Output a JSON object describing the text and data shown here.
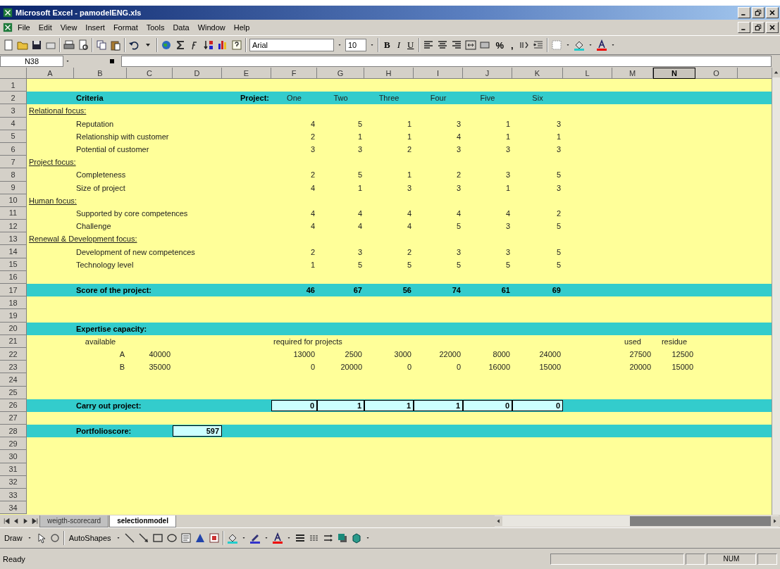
{
  "window": {
    "title": "Microsoft Excel - pamodelENG.xls"
  },
  "menu": [
    "File",
    "Edit",
    "View",
    "Insert",
    "Format",
    "Tools",
    "Data",
    "Window",
    "Help"
  ],
  "formatting": {
    "font": "Arial",
    "size": "10",
    "style_buttons": [
      "B",
      "I",
      "U"
    ],
    "number_buttons": [
      "%",
      ","
    ]
  },
  "formula_bar": {
    "name_box": "N38"
  },
  "columns": [
    {
      "label": "A",
      "selected": false
    },
    {
      "label": "B",
      "selected": false
    },
    {
      "label": "C",
      "selected": false
    },
    {
      "label": "D",
      "selected": false
    },
    {
      "label": "E",
      "selected": false
    },
    {
      "label": "F",
      "selected": false
    },
    {
      "label": "G",
      "selected": false
    },
    {
      "label": "H",
      "selected": false
    },
    {
      "label": "I",
      "selected": false
    },
    {
      "label": "J",
      "selected": false
    },
    {
      "label": "K",
      "selected": false
    },
    {
      "label": "L",
      "selected": false
    },
    {
      "label": "M",
      "selected": false
    },
    {
      "label": "N",
      "selected": true
    },
    {
      "label": "O",
      "selected": false
    }
  ],
  "rows": [
    {
      "number": "1",
      "band": false,
      "kind": "blank"
    },
    {
      "number": "2",
      "band": true,
      "kind": "header",
      "label": "Criteria",
      "caption": "Project:",
      "values": [
        "One",
        "Two",
        "Three",
        "Four",
        "Five",
        "Six"
      ]
    },
    {
      "number": "3",
      "band": false,
      "kind": "section",
      "label": "Relational focus:"
    },
    {
      "number": "4",
      "band": false,
      "kind": "item",
      "label": "Reputation",
      "values": [
        "4",
        "5",
        "1",
        "3",
        "1",
        "3"
      ]
    },
    {
      "number": "5",
      "band": false,
      "kind": "item",
      "label": "Relationship with customer",
      "values": [
        "2",
        "1",
        "1",
        "4",
        "1",
        "1"
      ]
    },
    {
      "number": "6",
      "band": false,
      "kind": "item",
      "label": "Potential of customer",
      "values": [
        "3",
        "3",
        "2",
        "3",
        "3",
        "3"
      ]
    },
    {
      "number": "7",
      "band": false,
      "kind": "section",
      "label": "Project focus:"
    },
    {
      "number": "8",
      "band": false,
      "kind": "item",
      "label": "Completeness",
      "values": [
        "2",
        "5",
        "1",
        "2",
        "3",
        "5"
      ]
    },
    {
      "number": "9",
      "band": false,
      "kind": "item",
      "label": "Size of project",
      "values": [
        "4",
        "1",
        "3",
        "3",
        "1",
        "3"
      ]
    },
    {
      "number": "10",
      "band": false,
      "kind": "section",
      "label": "Human focus:"
    },
    {
      "number": "11",
      "band": false,
      "kind": "item",
      "label": "Supported by core competences",
      "values": [
        "4",
        "4",
        "4",
        "4",
        "4",
        "2"
      ]
    },
    {
      "number": "12",
      "band": false,
      "kind": "item",
      "label": "Challenge",
      "values": [
        "4",
        "4",
        "4",
        "5",
        "3",
        "5"
      ]
    },
    {
      "number": "13",
      "band": false,
      "kind": "section",
      "label": "Renewal & Development focus:"
    },
    {
      "number": "14",
      "band": false,
      "kind": "item",
      "label": "Development of new competences",
      "values": [
        "2",
        "3",
        "2",
        "3",
        "3",
        "5"
      ]
    },
    {
      "number": "15",
      "band": false,
      "kind": "item",
      "label": "Technology level",
      "values": [
        "1",
        "5",
        "5",
        "5",
        "5",
        "5"
      ]
    },
    {
      "number": "16",
      "band": false,
      "kind": "blank"
    },
    {
      "number": "17",
      "band": true,
      "kind": "total",
      "label": "Score of the project:",
      "values": [
        "46",
        "67",
        "56",
        "74",
        "61",
        "69"
      ]
    },
    {
      "number": "18",
      "band": false,
      "kind": "blank"
    },
    {
      "number": "19",
      "band": false,
      "kind": "blank"
    },
    {
      "number": "20",
      "band": true,
      "kind": "title",
      "label": "Expertise capacity:"
    },
    {
      "number": "21",
      "band": false,
      "kind": "capacity-head",
      "label": "available",
      "note": "required for projects",
      "totals": [
        "used",
        "residue"
      ]
    },
    {
      "number": "22",
      "band": false,
      "kind": "capacity",
      "label": "A",
      "available": "40000",
      "values": [
        "13000",
        "2500",
        "3000",
        "22000",
        "8000",
        "24000"
      ],
      "totals": [
        "27500",
        "12500"
      ]
    },
    {
      "number": "23",
      "band": false,
      "kind": "capacity",
      "label": "B",
      "available": "35000",
      "values": [
        "0",
        "20000",
        "0",
        "0",
        "16000",
        "15000"
      ],
      "totals": [
        "20000",
        "15000"
      ]
    },
    {
      "number": "24",
      "band": false,
      "kind": "blank"
    },
    {
      "number": "25",
      "band": false,
      "kind": "blank"
    },
    {
      "number": "26",
      "band": true,
      "kind": "inputs",
      "label": "Carry out project:",
      "values": [
        "0",
        "1",
        "1",
        "1",
        "0",
        "0"
      ]
    },
    {
      "number": "27",
      "band": false,
      "kind": "blank"
    },
    {
      "number": "28",
      "band": true,
      "kind": "score",
      "label": "Portfolioscore:",
      "score": "597"
    },
    {
      "number": "29",
      "band": false,
      "kind": "blank"
    },
    {
      "number": "30",
      "band": false,
      "kind": "blank"
    },
    {
      "number": "31",
      "band": false,
      "kind": "blank"
    },
    {
      "number": "32",
      "band": false,
      "kind": "blank"
    },
    {
      "number": "33",
      "band": false,
      "kind": "blank"
    },
    {
      "number": "34",
      "band": false,
      "kind": "blank"
    }
  ],
  "sheet_tabs": [
    {
      "label": "weigth-scorecard",
      "selected": false
    },
    {
      "label": "selectionmodel",
      "selected": true
    }
  ],
  "drawing_toolbar": {
    "draw": "Draw",
    "autoshapes": "AutoShapes"
  },
  "status_bar": {
    "status": "Ready",
    "num": "NUM"
  }
}
